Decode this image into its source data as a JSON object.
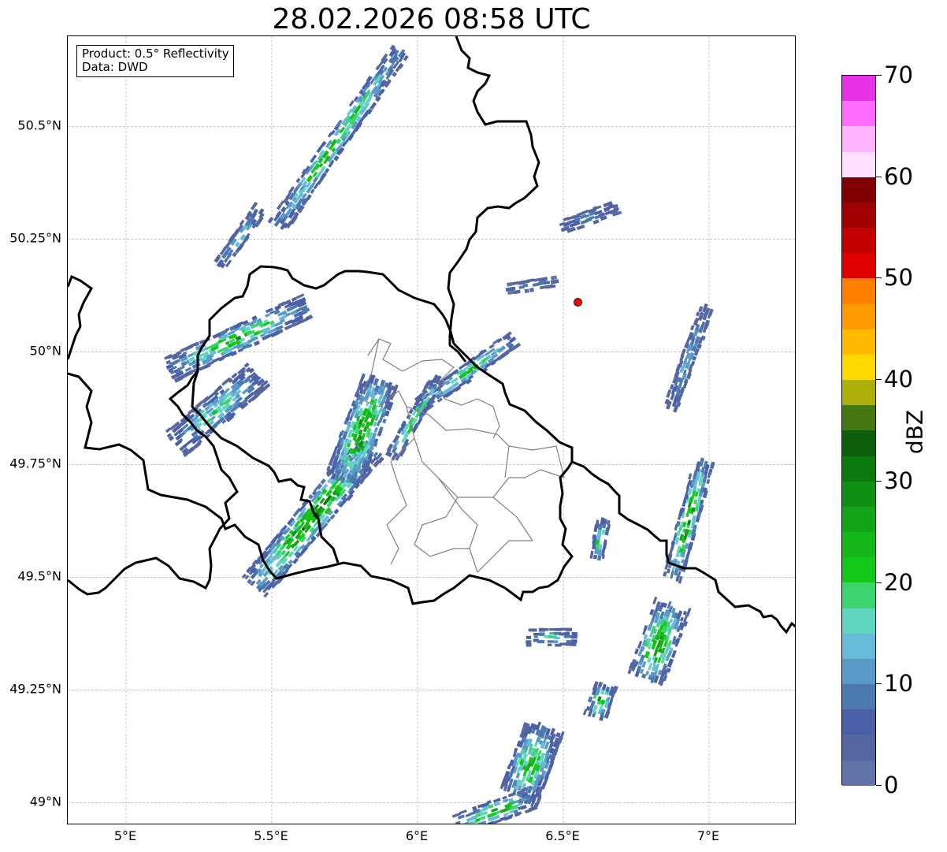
{
  "title": "28.02.2026 08:58 UTC",
  "info_box": {
    "product": "Product: 0.5° Reflectivity",
    "source": "Data: DWD"
  },
  "axes": {
    "x_ticks": [
      {
        "value": 5.0,
        "label": "5°E"
      },
      {
        "value": 5.5,
        "label": "5.5°E"
      },
      {
        "value": 6.0,
        "label": "6°E"
      },
      {
        "value": 6.5,
        "label": "6.5°E"
      },
      {
        "value": 7.0,
        "label": "7°E"
      }
    ],
    "y_ticks": [
      {
        "value": 49.0,
        "label": "49°N"
      },
      {
        "value": 49.25,
        "label": "49.25°N"
      },
      {
        "value": 49.5,
        "label": "49.5°N"
      },
      {
        "value": 49.75,
        "label": "49.75°N"
      },
      {
        "value": 50.0,
        "label": "50°N"
      },
      {
        "value": 50.25,
        "label": "50.25°N"
      },
      {
        "value": 50.5,
        "label": "50.5°N"
      }
    ],
    "lon_range": [
      4.8,
      7.3
    ],
    "lat_range": [
      48.95,
      50.7
    ],
    "grid": true
  },
  "colorbar": {
    "unit": "dBZ",
    "min": 0,
    "max": 70,
    "tick_labels": [
      "0",
      "10",
      "20",
      "30",
      "40",
      "50",
      "60",
      "70"
    ],
    "colors": [
      "#6273a8",
      "#5566a0",
      "#4a60a8",
      "#4c7ab0",
      "#5a9ac6",
      "#66bcd8",
      "#5fd6c0",
      "#3cd46e",
      "#12c818",
      "#14b81a",
      "#12a616",
      "#0e9012",
      "#0b7a0e",
      "#0a5e0c",
      "#457810",
      "#aeb00a",
      "#ffd800",
      "#ffb900",
      "#ff9b00",
      "#ff7f00",
      "#e00000",
      "#c40000",
      "#a00000",
      "#800000",
      "#ffe0ff",
      "#ffb4ff",
      "#ff6cff",
      "#e832e8"
    ]
  },
  "radar_site": {
    "lon": 6.55,
    "lat": 50.11,
    "color": "#ff0000"
  },
  "map_colors": {
    "country_border": "#000000",
    "admin_border": "#808080",
    "grid": "#b0b0b0",
    "echo_base": "#4f6fae",
    "echo_mid": "#5fc8d0",
    "echo_core": "#12c818"
  },
  "echoes": [
    {
      "lon": 5.72,
      "lat": 50.47,
      "len": 0.72,
      "wid": 0.06,
      "angle": -55,
      "peak": 22
    },
    {
      "lon": 5.38,
      "lat": 50.25,
      "len": 0.22,
      "wid": 0.04,
      "angle": -55,
      "peak": 14
    },
    {
      "lon": 5.37,
      "lat": 50.03,
      "len": 0.5,
      "wid": 0.08,
      "angle": -25,
      "peak": 22
    },
    {
      "lon": 5.3,
      "lat": 49.87,
      "len": 0.35,
      "wid": 0.1,
      "angle": -40,
      "peak": 16
    },
    {
      "lon": 5.63,
      "lat": 49.63,
      "len": 0.6,
      "wid": 0.1,
      "angle": -50,
      "peak": 28
    },
    {
      "lon": 5.8,
      "lat": 49.82,
      "len": 0.35,
      "wid": 0.12,
      "angle": -70,
      "peak": 26
    },
    {
      "lon": 6.15,
      "lat": 49.95,
      "len": 0.4,
      "wid": 0.05,
      "angle": -35,
      "peak": 20
    },
    {
      "lon": 6.92,
      "lat": 49.62,
      "len": 0.4,
      "wid": 0.06,
      "angle": -75,
      "peak": 26
    },
    {
      "lon": 6.92,
      "lat": 49.98,
      "len": 0.35,
      "wid": 0.04,
      "angle": -70,
      "peak": 12
    },
    {
      "lon": 6.82,
      "lat": 49.35,
      "len": 0.25,
      "wid": 0.12,
      "angle": -70,
      "peak": 26
    },
    {
      "lon": 6.62,
      "lat": 49.22,
      "len": 0.1,
      "wid": 0.07,
      "angle": -70,
      "peak": 24
    },
    {
      "lon": 6.38,
      "lat": 49.08,
      "len": 0.25,
      "wid": 0.13,
      "angle": -70,
      "peak": 22
    },
    {
      "lon": 6.25,
      "lat": 48.98,
      "len": 0.25,
      "wid": 0.07,
      "angle": -20,
      "peak": 24
    },
    {
      "lon": 6.45,
      "lat": 49.37,
      "len": 0.15,
      "wid": 0.05,
      "angle": 0,
      "peak": 14
    },
    {
      "lon": 6.62,
      "lat": 49.58,
      "len": 0.12,
      "wid": 0.04,
      "angle": -80,
      "peak": 20
    },
    {
      "lon": 5.98,
      "lat": 49.85,
      "len": 0.3,
      "wid": 0.04,
      "angle": -60,
      "peak": 22
    },
    {
      "lon": 6.58,
      "lat": 50.3,
      "len": 0.2,
      "wid": 0.04,
      "angle": -20,
      "peak": 8
    },
    {
      "lon": 6.38,
      "lat": 50.15,
      "len": 0.15,
      "wid": 0.03,
      "angle": -10,
      "peak": 8
    }
  ]
}
